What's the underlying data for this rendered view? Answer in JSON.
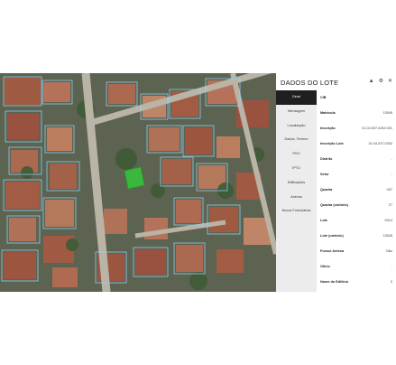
{
  "panel": {
    "title": "DADOS DO LOTE",
    "icons": [
      "user-icon",
      "gear-icon",
      "close-icon"
    ],
    "icon_glyphs": {
      "user": "▲",
      "gear": "⚙",
      "close": "✕"
    }
  },
  "tabs": [
    {
      "label": "Geral",
      "active": true
    },
    {
      "label": "Mensagem"
    },
    {
      "label": "Localização"
    },
    {
      "label": "Dados, Terreno"
    },
    {
      "label": "PGV"
    },
    {
      "label": "IPTU"
    },
    {
      "label": "Edificações"
    },
    {
      "label": "Anexos"
    },
    {
      "label": "Novos Formulários"
    }
  ],
  "fields": [
    {
      "label": "CIB",
      "value": ""
    },
    {
      "label": "Matrícula",
      "value": "13549"
    },
    {
      "label": "Inscrição",
      "value": "01.04.037.0262.001"
    },
    {
      "label": "Inscrição Lote",
      "value": "01.04.037.0262"
    },
    {
      "label": "Distrito",
      "value": "-"
    },
    {
      "label": "Setor",
      "value": "-"
    },
    {
      "label": "Quadra",
      "value": "037"
    },
    {
      "label": "Quadra (cartório)",
      "value": "27"
    },
    {
      "label": "Lote",
      "value": "0014"
    },
    {
      "label": "Lote (cartório)",
      "value": "13545"
    },
    {
      "label": "Possui Antena",
      "value": "Não"
    },
    {
      "label": "Ofício",
      "value": "-"
    },
    {
      "label": "Nome do Edifício",
      "value": "0"
    }
  ],
  "colors": {
    "tab_active_bg": "#1f1f1f",
    "tab_bg": "#ececec",
    "highlight_lot": "#36c23a",
    "parcel_lines": "#8fd8ff"
  }
}
